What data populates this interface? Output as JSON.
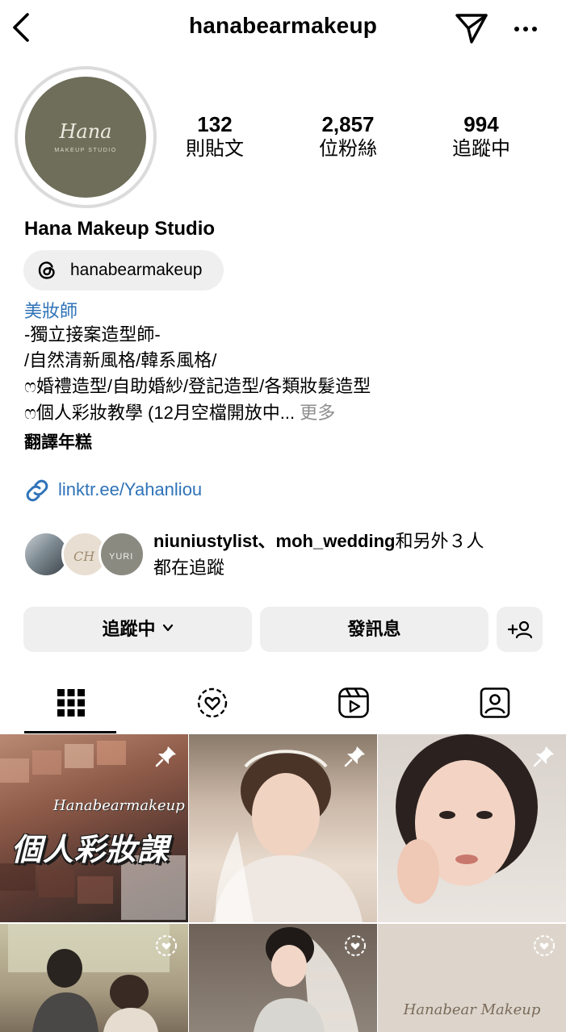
{
  "header": {
    "username": "hanabearmakeup",
    "icons": {
      "back": "chevron-left-icon",
      "send": "paper-plane-icon",
      "more": "ellipsis-icon"
    }
  },
  "profile": {
    "avatar_text": "Hana",
    "avatar_subtext": "MAKEUP STUDIO",
    "avatar_color": "#6f6e5a",
    "stats": [
      {
        "value": "132",
        "label": "則貼文"
      },
      {
        "value": "2,857",
        "label": "位粉絲"
      },
      {
        "value": "994",
        "label": "追蹤中"
      }
    ],
    "display_name": "Hana Makeup Studio",
    "threads_handle": "hanabearmakeup",
    "category": "美妝師",
    "bio_lines": [
      "-獨立接案造型師-",
      "/自然清新風格/韓系風格/",
      "ෆ婚禮造型/自助婚紗/登記造型/各類妝髮造型",
      "ෆ個人彩妝教學 (12月空檔開放中..."
    ],
    "more_label": "更多",
    "translate_label": "翻譯年糕",
    "link": "linktr.ee/Yahanliou",
    "mutual_followers": {
      "names": "niuniustylist、moh_wedding",
      "suffix": "和另外３人",
      "line2": "都在追蹤"
    }
  },
  "actions": {
    "following_label": "追蹤中",
    "message_label": "發訊息"
  },
  "tabs": [
    {
      "name": "grid",
      "icon": "grid-icon",
      "active": true
    },
    {
      "name": "reels-highlight",
      "icon": "heart-circle-icon",
      "active": false
    },
    {
      "name": "reels",
      "icon": "reels-icon",
      "active": false
    },
    {
      "name": "tagged",
      "icon": "tagged-user-icon",
      "active": false
    }
  ],
  "posts": [
    {
      "id": "post-1",
      "title": "個人彩妝課",
      "script": "Hanabearmakeup",
      "badge": "pin-icon"
    },
    {
      "id": "post-2",
      "badge": "pin-icon"
    },
    {
      "id": "post-3",
      "badge": "pin-icon"
    },
    {
      "id": "post-4",
      "badge": "reel-icon"
    },
    {
      "id": "post-5",
      "badge": "reel-icon"
    },
    {
      "id": "post-6",
      "script": "Hanabear Makeup",
      "badge": "reel-icon"
    }
  ],
  "colors": {
    "link": "#2f73b8",
    "button_bg": "#efefef",
    "muted": "#8e8e8e"
  }
}
